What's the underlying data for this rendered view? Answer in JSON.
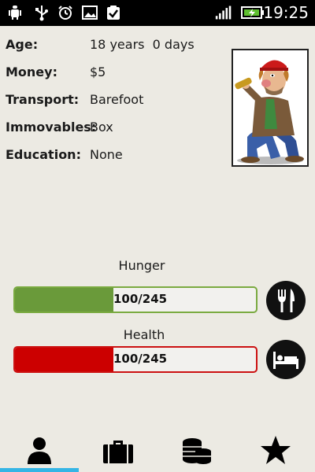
{
  "status_bar": {
    "time": "19:25",
    "icons": [
      "android-debug-icon",
      "usb-icon",
      "alarm-icon",
      "image-icon",
      "clipboard-check-icon",
      "signal-icon",
      "battery-icon"
    ]
  },
  "profile": {
    "rows": [
      {
        "label": "Age:",
        "value": "18 years  0 days"
      },
      {
        "label": "Money:",
        "value": "$5"
      },
      {
        "label": "Transport:",
        "value": "Barefoot"
      },
      {
        "label": "Immovables:",
        "value": "Box"
      },
      {
        "label": "Education:",
        "value": "None"
      }
    ]
  },
  "stats": {
    "hunger": {
      "title": "Hunger",
      "value_text": "100/245",
      "level": 0.41,
      "fill_color": "#6a9a3a",
      "border_color": "#7aaa40",
      "icon": "fork-knife-icon"
    },
    "health": {
      "title": "Health",
      "value_text": "100/245",
      "level": 0.41,
      "fill_color": "#cc0000",
      "border_color": "#cc1111",
      "icon": "bed-icon"
    }
  },
  "bottom_nav": {
    "items": [
      "person-icon",
      "briefcase-icon",
      "coins-icon",
      "star-icon"
    ],
    "active_index": 0,
    "accent_color": "#35b5e5"
  }
}
